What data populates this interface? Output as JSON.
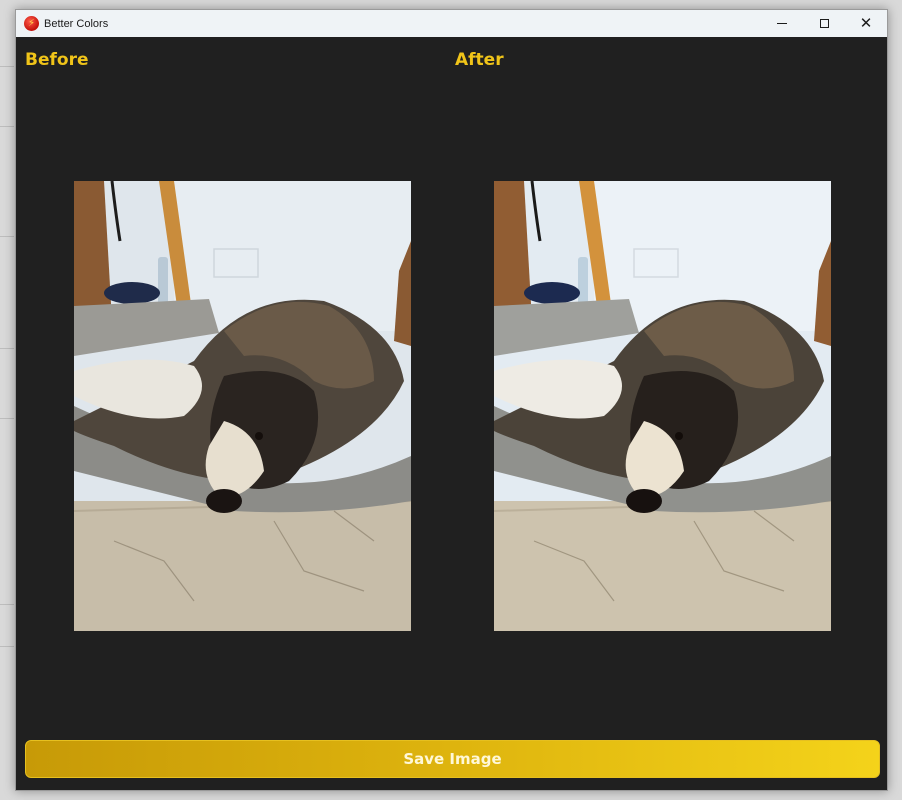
{
  "window": {
    "title": "Better Colors",
    "icon": "lightning-bolt-icon",
    "accent_color": "#f0c419",
    "background_color": "#202020"
  },
  "controls": {
    "minimize_icon": "minimize-icon",
    "maximize_icon": "maximize-icon",
    "close_icon": "close-icon"
  },
  "panels": {
    "before_label": "Before",
    "after_label": "After"
  },
  "actions": {
    "save_label": "Save Image"
  }
}
